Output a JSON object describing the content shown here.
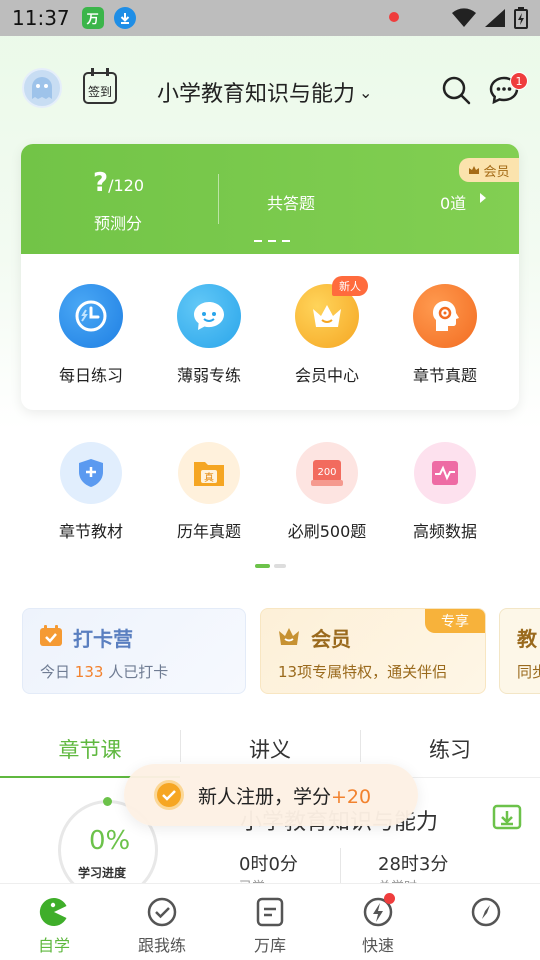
{
  "status_bar": {
    "time": "11:37",
    "app1_glyph": "万"
  },
  "header": {
    "signin_label": "签到",
    "subject": "小学教育知识与能力",
    "message_count": "1"
  },
  "score_card": {
    "vip_label": "会员",
    "predicted_score": "?",
    "predicted_total": "/120",
    "predicted_label": "预测分",
    "answered_label": "共答题",
    "answered_count": "0道"
  },
  "quick_actions": [
    {
      "label": "每日练习",
      "icon": "clock-bolt-icon"
    },
    {
      "label": "薄弱专练",
      "icon": "chat-face-icon"
    },
    {
      "label": "会员中心",
      "icon": "crown-icon",
      "badge": "新人"
    },
    {
      "label": "章节真题",
      "icon": "head-gear-icon"
    }
  ],
  "secondary_grid": [
    {
      "label": "章节教材",
      "icon": "shield-plus-icon"
    },
    {
      "label": "历年真题",
      "icon": "folder-zhen-icon"
    },
    {
      "label": "必刷500题",
      "icon": "card-200-icon"
    },
    {
      "label": "高频数据",
      "icon": "pulse-chart-icon"
    }
  ],
  "promos": {
    "checkin": {
      "title": "打卡营",
      "sub_prefix": "今日",
      "count": "133",
      "sub_suffix": "人已打卡"
    },
    "vip": {
      "title": "会员",
      "tag": "专享",
      "sub": "13项专属特权，通关伴侣"
    },
    "third": {
      "title": "教",
      "sub": "同步"
    }
  },
  "tabs": [
    "章节课",
    "讲义",
    "练习"
  ],
  "course": {
    "progress_value": "0%",
    "progress_label": "学习进度",
    "title": "小学教育知识与能力",
    "stat1_value": "0时0分",
    "stat1_label": "已学",
    "stat2_value": "28时3分",
    "stat2_label": "总学时"
  },
  "toast": {
    "text": "新人注册，学分",
    "plus": "+20"
  },
  "bottom_nav": [
    {
      "label": "自学",
      "icon": "pacman-icon",
      "active": true
    },
    {
      "label": "跟我练",
      "icon": "check-circle-icon"
    },
    {
      "label": "万库",
      "icon": "doc-lines-icon"
    },
    {
      "label": "快速",
      "icon": "bolt-circle-icon"
    },
    {
      "label": "",
      "icon": "compass-icon"
    }
  ],
  "colors": {
    "accent_green": "#6cc24a",
    "badge_red": "#ef3d3d",
    "vip_gold": "#f7b23b"
  }
}
